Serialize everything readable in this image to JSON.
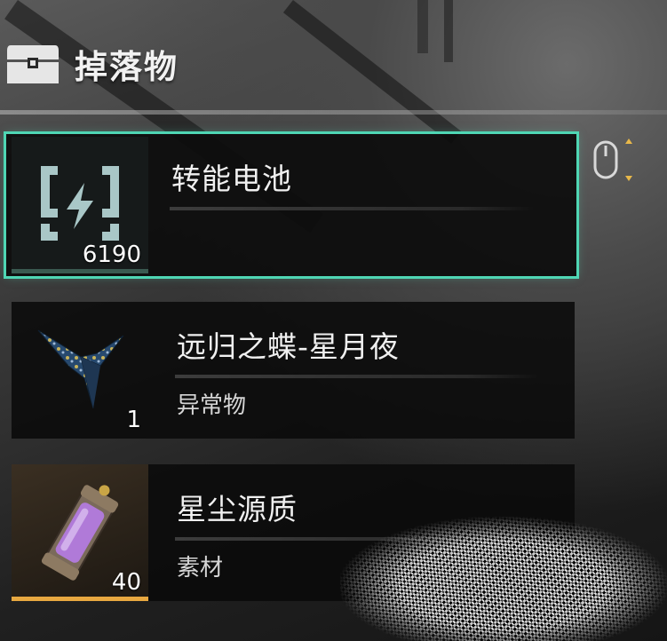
{
  "header": {
    "title": "掉落物",
    "icon": "treasure-chest-icon"
  },
  "items": [
    {
      "name": "转能电池",
      "type": "",
      "count": "6190",
      "icon": "energy-battery-icon",
      "selected": true,
      "rarity_color": "#4fd6b4"
    },
    {
      "name": "远归之蝶-星月夜",
      "type": "异常物",
      "count": "1",
      "icon": "butterfly-wing-icon",
      "selected": false,
      "rarity_color": "#1e1e1e"
    },
    {
      "name": "星尘源质",
      "type": "素材",
      "count": "40",
      "icon": "stardust-canister-icon",
      "selected": false,
      "rarity_color": "#e8a840"
    }
  ],
  "hints": {
    "scroll_icon": "mouse-scroll-icon"
  }
}
